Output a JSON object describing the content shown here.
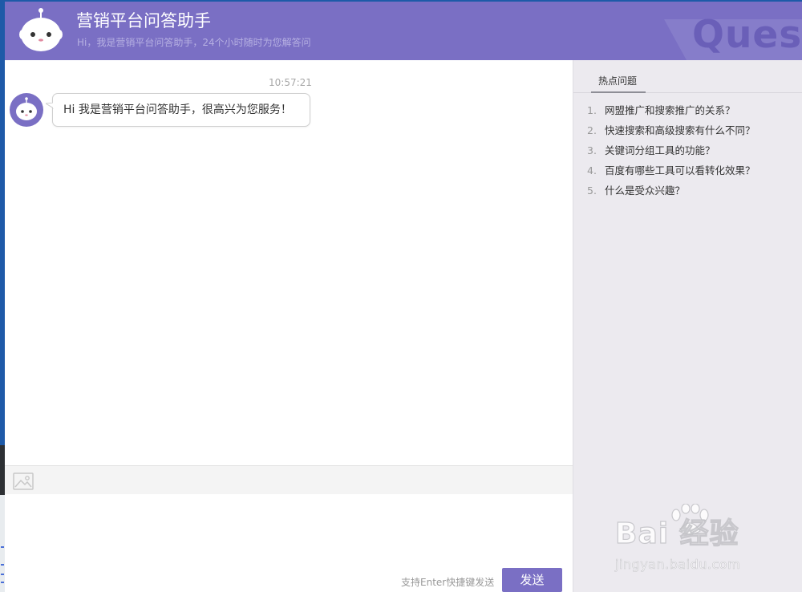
{
  "app": {
    "title": "营销平台问答助手",
    "subtitle": "Hi，我是营销平台问答助手，24个小时随时为您解答问",
    "header_decoration_text": "Questi"
  },
  "colors": {
    "brand_purple": "#7a6fc4",
    "panel_bg": "#eceaef"
  },
  "chat": {
    "messages": [
      {
        "sender": "bot",
        "time": "10:57:21",
        "text": "Hi 我是营销平台问答助手，很高兴为您服务！"
      }
    ]
  },
  "composer": {
    "toolbar_icon": "image-icon",
    "input_value": "",
    "hint": "支持Enter快捷键发送",
    "send_label": "发送"
  },
  "hot_questions": {
    "title": "热点问题",
    "items": [
      {
        "num": "1.",
        "text": "网盟推广和搜索推广的关系？"
      },
      {
        "num": "2.",
        "text": "快速搜索和高级搜索有什么不同？"
      },
      {
        "num": "3.",
        "text": "关键词分组工具的功能？"
      },
      {
        "num": "4.",
        "text": "百度有哪些工具可以看转化效果？"
      },
      {
        "num": "5.",
        "text": "什么是受众兴趣？"
      }
    ]
  },
  "watermark": {
    "brand": "Bai  经验",
    "url": "jingyan.baidu.com"
  }
}
